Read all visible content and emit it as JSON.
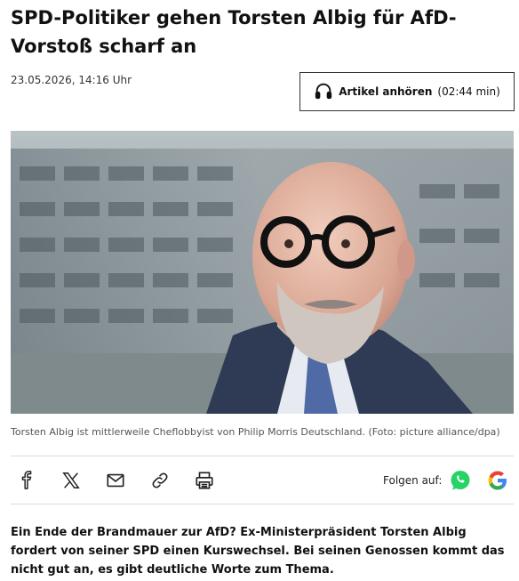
{
  "article": {
    "headline": "SPD-Politiker gehen Torsten Albig für AfD-Vorstoß scharf an",
    "date": "23.05.2026, 14:16 Uhr",
    "listen": {
      "label": "Artikel anhören",
      "duration": "(02:44 min)",
      "icon": "headphones-icon"
    },
    "image_caption": "Torsten Albig ist mittlerweile Cheflobbyist von Philip Morris Deutschland. (Foto: picture alliance/dpa)",
    "intro": "Ein Ende der Brandmauer zur AfD? Ex-Ministerpräsident Torsten Albig fordert von seiner SPD einen Kurswechsel. Bei seinen Genossen kommt das nicht gut an, es gibt deutliche Worte zum Thema."
  },
  "share_bar": {
    "icons": [
      "facebook-icon",
      "x-icon",
      "mail-icon",
      "link-icon",
      "print-icon"
    ],
    "follow_label": "Folgen auf:",
    "follow_icons": [
      "whatsapp-icon",
      "google-icon"
    ]
  },
  "colors": {
    "whatsapp": "#25D366",
    "google_blue": "#4285F4",
    "google_red": "#EA4335",
    "google_yellow": "#FBBC05",
    "google_green": "#34A853"
  }
}
